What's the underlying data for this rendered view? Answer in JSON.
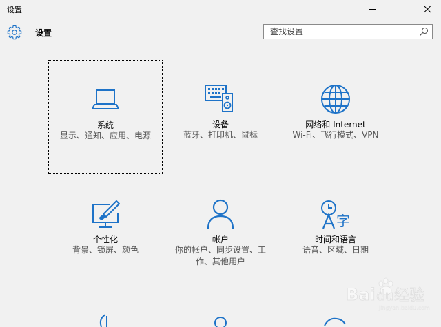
{
  "window": {
    "title": "设置"
  },
  "header": {
    "title": "设置"
  },
  "search": {
    "placeholder": "查找设置"
  },
  "tiles": [
    {
      "name": "系统",
      "desc": "显示、通知、应用、电源"
    },
    {
      "name": "设备",
      "desc": "蓝牙、打印机、鼠标"
    },
    {
      "name": "网络和 Internet",
      "desc": "Wi-Fi、飞行模式、VPN"
    },
    {
      "name": "个性化",
      "desc": "背景、锁屏、颜色"
    },
    {
      "name": "帐户",
      "desc": "你的帐户、同步设置、工作、其他用户"
    },
    {
      "name": "时间和语言",
      "desc": "语音、区域、日期"
    }
  ],
  "colors": {
    "accent": "#1e73c8",
    "background": "#f1f1f1"
  },
  "watermark": {
    "text": "Bai 经验",
    "sub": "jingyan.baidu.com"
  }
}
